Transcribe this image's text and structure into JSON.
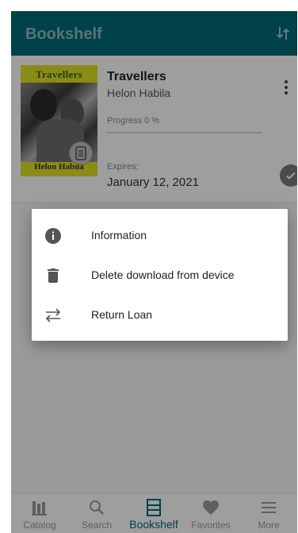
{
  "appbar": {
    "title": "Bookshelf",
    "sort_icon": "sort-arrows-icon"
  },
  "book": {
    "cover_title": "Travellers",
    "cover_author": "Helon Habila",
    "title": "Travellers",
    "author": "Helon Habila",
    "progress_label": "Progress 0 %",
    "progress": 0,
    "expires_label": "Expires:",
    "expires_date": "January 12, 2021"
  },
  "menu": {
    "items": [
      {
        "label": "Information",
        "icon": "info-icon"
      },
      {
        "label": "Delete download from device",
        "icon": "trash-icon"
      },
      {
        "label": "Return Loan",
        "icon": "swap-arrows-icon"
      }
    ]
  },
  "nav": {
    "items": [
      {
        "label": "Catalog",
        "icon": "library-icon"
      },
      {
        "label": "Search",
        "icon": "search-icon"
      },
      {
        "label": "Bookshelf",
        "icon": "bookshelf-icon"
      },
      {
        "label": "Favorites",
        "icon": "heart-icon"
      },
      {
        "label": "More",
        "icon": "menu-icon"
      }
    ],
    "active": "Bookshelf"
  },
  "colors": {
    "primary": "#006a78",
    "inactive": "#9a9a9a",
    "dialog_icon": "#555555"
  }
}
